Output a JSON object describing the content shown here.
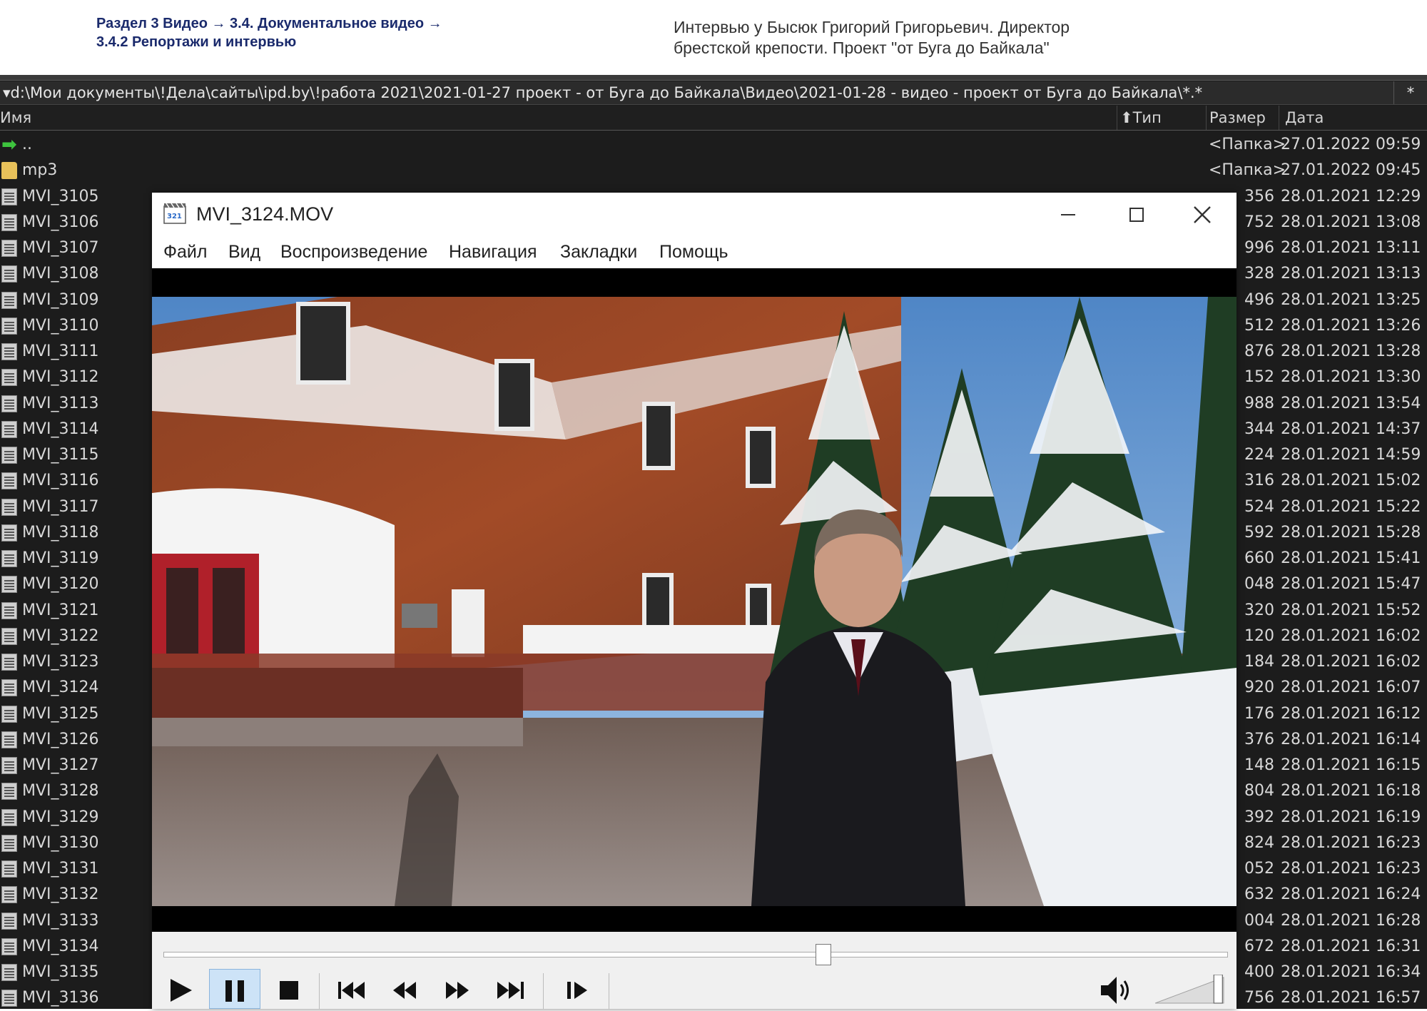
{
  "header": {
    "breadcrumb_line1": "Раздел 3 Видео  → 3.4. Документальное видео →",
    "breadcrumb_line2": "3.4.2 Репортажи и интервью",
    "caption_line1": "Интервью у Бысюк Григорий Григорьевич. Директор",
    "caption_line2": "брестской крепости. Проект \"от Буга до Байкала\""
  },
  "file_manager": {
    "path": "d:\\Мои документы\\!Дела\\сайты\\ipd.by\\!работа 2021\\2021-01-27 проект - от Буга до Байкала\\Видео\\2021-01-28 - видео - проект от Буга до Байкала\\*.*",
    "path_button": "*",
    "columns": {
      "name": "Имя",
      "type": "Тип",
      "size": "Размер",
      "date": "Дата"
    },
    "rows": [
      {
        "icon": "up-arrow-icon",
        "name": "..",
        "size": "<Папка>",
        "date": "27.01.2022 09:59"
      },
      {
        "icon": "folder-icon",
        "name": "mp3",
        "size": "<Папка>",
        "date": "27.01.2022 09:45"
      },
      {
        "icon": "file-icon",
        "name": "MVI_3105",
        "size": "356",
        "date": "28.01.2021 12:29"
      },
      {
        "icon": "file-icon",
        "name": "MVI_3106",
        "size": "752",
        "date": "28.01.2021 13:08"
      },
      {
        "icon": "file-icon",
        "name": "MVI_3107",
        "size": "996",
        "date": "28.01.2021 13:11"
      },
      {
        "icon": "file-icon",
        "name": "MVI_3108",
        "size": "328",
        "date": "28.01.2021 13:13"
      },
      {
        "icon": "file-icon",
        "name": "MVI_3109",
        "size": "496",
        "date": "28.01.2021 13:25"
      },
      {
        "icon": "file-icon",
        "name": "MVI_3110",
        "size": "512",
        "date": "28.01.2021 13:26"
      },
      {
        "icon": "file-icon",
        "name": "MVI_3111",
        "size": "876",
        "date": "28.01.2021 13:28"
      },
      {
        "icon": "file-icon",
        "name": "MVI_3112",
        "size": "152",
        "date": "28.01.2021 13:30"
      },
      {
        "icon": "file-icon",
        "name": "MVI_3113",
        "size": "988",
        "date": "28.01.2021 13:54"
      },
      {
        "icon": "file-icon",
        "name": "MVI_3114",
        "size": "344",
        "date": "28.01.2021 14:37"
      },
      {
        "icon": "file-icon",
        "name": "MVI_3115",
        "size": "224",
        "date": "28.01.2021 14:59"
      },
      {
        "icon": "file-icon",
        "name": "MVI_3116",
        "size": "316",
        "date": "28.01.2021 15:02"
      },
      {
        "icon": "file-icon",
        "name": "MVI_3117",
        "size": "524",
        "date": "28.01.2021 15:22"
      },
      {
        "icon": "file-icon",
        "name": "MVI_3118",
        "size": "592",
        "date": "28.01.2021 15:28"
      },
      {
        "icon": "file-icon",
        "name": "MVI_3119",
        "size": "660",
        "date": "28.01.2021 15:41"
      },
      {
        "icon": "file-icon",
        "name": "MVI_3120",
        "size": "048",
        "date": "28.01.2021 15:47"
      },
      {
        "icon": "file-icon",
        "name": "MVI_3121",
        "size": "320",
        "date": "28.01.2021 15:52"
      },
      {
        "icon": "file-icon",
        "name": "MVI_3122",
        "size": "120",
        "date": "28.01.2021 16:02"
      },
      {
        "icon": "file-icon",
        "name": "MVI_3123",
        "size": "184",
        "date": "28.01.2021 16:02"
      },
      {
        "icon": "file-icon",
        "name": "MVI_3124",
        "size": "920",
        "date": "28.01.2021 16:07"
      },
      {
        "icon": "file-icon",
        "name": "MVI_3125",
        "size": "176",
        "date": "28.01.2021 16:12"
      },
      {
        "icon": "file-icon",
        "name": "MVI_3126",
        "size": "376",
        "date": "28.01.2021 16:14"
      },
      {
        "icon": "file-icon",
        "name": "MVI_3127",
        "size": "148",
        "date": "28.01.2021 16:15"
      },
      {
        "icon": "file-icon",
        "name": "MVI_3128",
        "size": "804",
        "date": "28.01.2021 16:18"
      },
      {
        "icon": "file-icon",
        "name": "MVI_3129",
        "size": "392",
        "date": "28.01.2021 16:19"
      },
      {
        "icon": "file-icon",
        "name": "MVI_3130",
        "size": "824",
        "date": "28.01.2021 16:23"
      },
      {
        "icon": "file-icon",
        "name": "MVI_3131",
        "size": "052",
        "date": "28.01.2021 16:23"
      },
      {
        "icon": "file-icon",
        "name": "MVI_3132",
        "size": "632",
        "date": "28.01.2021 16:24"
      },
      {
        "icon": "file-icon",
        "name": "MVI_3133",
        "size": "004",
        "date": "28.01.2021 16:28"
      },
      {
        "icon": "file-icon",
        "name": "MVI_3134",
        "size": "672",
        "date": "28.01.2021 16:31"
      },
      {
        "icon": "file-icon",
        "name": "MVI_3135",
        "size": "400",
        "date": "28.01.2021 16:34"
      },
      {
        "icon": "file-icon",
        "name": "MVI_3136",
        "size": "756",
        "date": "28.01.2021 16:57"
      }
    ]
  },
  "player": {
    "title": "MVI_3124.MOV",
    "menu": [
      "Файл",
      "Вид",
      "Воспроизведение",
      "Навигация",
      "Закладки",
      "Помощь"
    ],
    "playback_progress": 0.62,
    "volume_level": 0.92,
    "state": "paused",
    "icons": {
      "minimize": "minimize-icon",
      "maximize": "maximize-icon",
      "close": "close-icon",
      "play": "play-icon",
      "pause": "pause-icon",
      "stop": "stop-icon",
      "prev": "skip-previous-icon",
      "rewind": "rewind-icon",
      "forward": "fast-forward-icon",
      "next": "skip-next-icon",
      "frame_step": "frame-step-icon",
      "volume": "speaker-icon"
    }
  }
}
